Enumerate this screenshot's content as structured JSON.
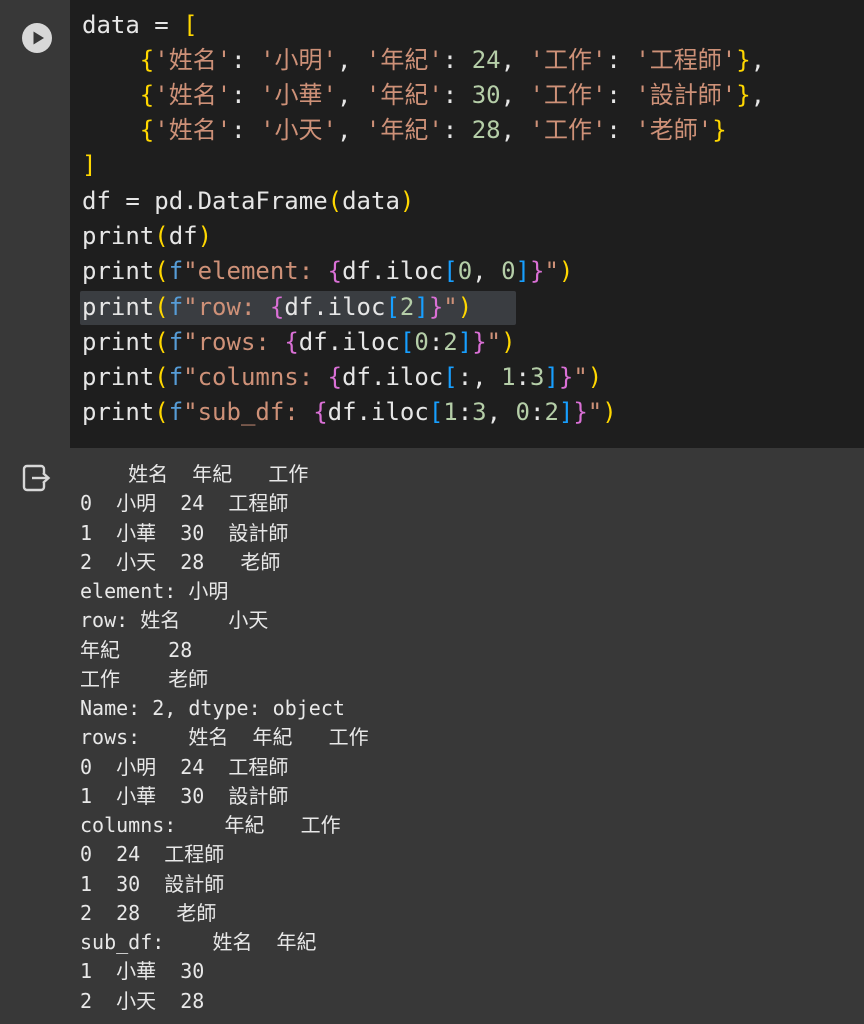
{
  "code": {
    "lines": [
      "data = [",
      "    {'姓名': '小明', '年紀': 24, '工作': '工程師'},",
      "    {'姓名': '小華', '年紀': 30, '工作': '設計師'},",
      "    {'姓名': '小天', '年紀': 28, '工作': '老師'}",
      "]",
      "df = pd.DataFrame(data)",
      "print(df)",
      "print(f\"element: {df.iloc[0, 0]}\")",
      "print(f\"row: {df.iloc[2]}\")",
      "print(f\"rows: {df.iloc[0:2]}\")",
      "print(f\"columns: {df.iloc[:, 1:3]}\")",
      "print(f\"sub_df: {df.iloc[1:3, 0:2]}\")"
    ]
  },
  "output": {
    "lines": [
      "    姓名  年紀   工作",
      "0  小明  24  工程師",
      "1  小華  30  設計師",
      "2  小天  28   老師",
      "element: 小明",
      "row: 姓名    小天",
      "年紀    28",
      "工作    老師",
      "Name: 2, dtype: object",
      "rows:    姓名  年紀   工作",
      "0  小明  24  工程師",
      "1  小華  30  設計師",
      "columns:    年紀   工作",
      "0  24  工程師",
      "1  30  設計師",
      "2  28   老師",
      "sub_df:    姓名  年紀",
      "1  小華  30",
      "2  小天  28"
    ]
  },
  "icons": {
    "run": "play-circle-icon",
    "output": "output-arrow-icon"
  },
  "colors": {
    "code_bg": "#1e1e1e",
    "output_bg": "#383838",
    "bracket_yellow": "#ffd700",
    "bracket_purple": "#da70d6",
    "bracket_blue": "#179fff",
    "string": "#ce9178",
    "number": "#b5cea8",
    "function": "#dcdcaa"
  }
}
